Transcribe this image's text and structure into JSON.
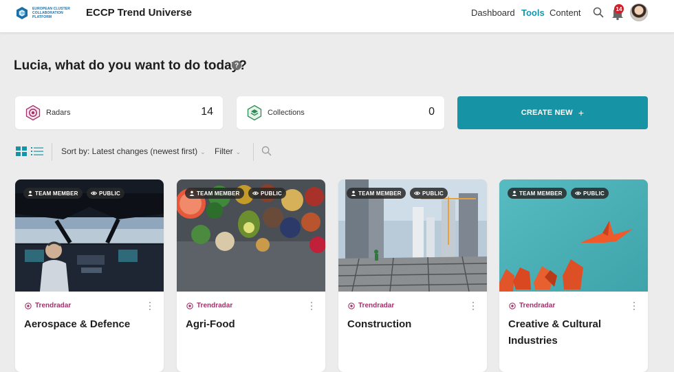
{
  "header": {
    "logo_text": "EUROPEAN CLUSTER COLLABORATION PLATFORM",
    "app_title": "ECCP Trend Universe",
    "nav": [
      {
        "label": "Dashboard",
        "active": false
      },
      {
        "label": "Tools",
        "active": true
      },
      {
        "label": "Content",
        "active": false
      }
    ],
    "notification_count": "14",
    "accent_color": "#1694a6",
    "icons": [
      "search-icon",
      "bell-icon",
      "avatar"
    ]
  },
  "greeting": {
    "text": "Lucia, what do you want to do today?",
    "help_icon": "question-circle-icon"
  },
  "stats": {
    "radars": {
      "label": "Radars",
      "count": "14",
      "icon": "radar-icon"
    },
    "collections": {
      "label": "Collections",
      "count": "0",
      "icon": "collection-icon"
    }
  },
  "create_button": {
    "label": "CREATE NEW",
    "plus": "+"
  },
  "toolbar": {
    "sort_label": "Sort by: Latest changes (newest first)",
    "filter_label": "Filter",
    "view_modes": [
      "grid-view-icon",
      "list-view-icon"
    ],
    "active_view": "grid"
  },
  "cards": [
    {
      "team_label": "TEAM MEMBER",
      "visibility_label": "PUBLIC",
      "type": "Trendradar",
      "title": "Aerospace & Defence",
      "image": "aircraft cockpit"
    },
    {
      "team_label": "TEAM MEMBER",
      "visibility_label": "PUBLIC",
      "type": "Trendradar",
      "title": "Agri-Food",
      "image": "fresh produce"
    },
    {
      "team_label": "TEAM MEMBER",
      "visibility_label": "PUBLIC",
      "type": "Trendradar",
      "title": "Construction",
      "image": "building site"
    },
    {
      "team_label": "TEAM MEMBER",
      "visibility_label": "PUBLIC",
      "type": "Trendradar",
      "title": "Creative & Cultural Industries",
      "image": "paper origami"
    }
  ]
}
